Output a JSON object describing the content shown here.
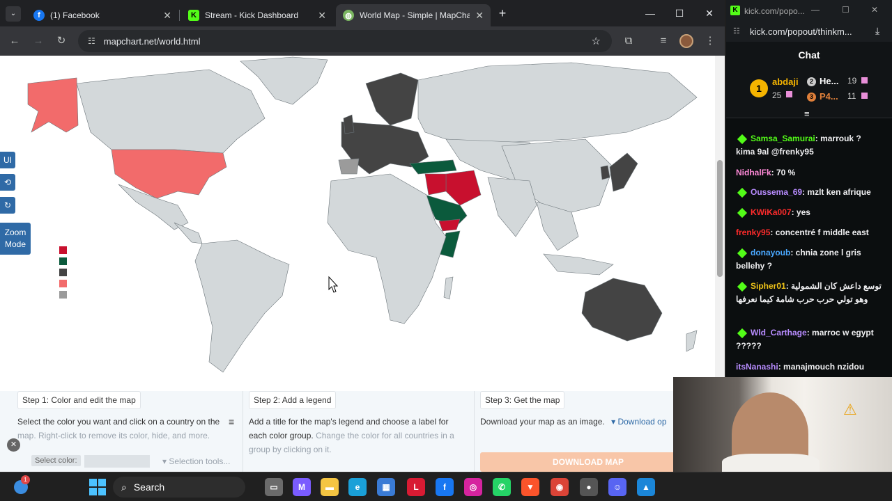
{
  "browser": {
    "tabs": [
      {
        "title": "(1) Facebook",
        "icon": "facebook-icon",
        "color": "#1877f2",
        "glyph": "f"
      },
      {
        "title": "Stream - Kick Dashboard",
        "icon": "kick-icon",
        "color": "#53fc18",
        "glyph": "K"
      },
      {
        "title": "World Map - Simple | MapChar",
        "icon": "globe-icon",
        "color": "#7bb661",
        "glyph": "◍"
      }
    ],
    "url": "mapchart.net/world.html"
  },
  "mapchart": {
    "side_buttons": [
      "UI",
      "⟲",
      "↻",
      "Zoom Mode"
    ],
    "legend_colors": [
      "#c8102e",
      "#0b5a3c",
      "#444444",
      "#f26b6b",
      "#9b9b9b"
    ],
    "steps": [
      {
        "tab": "Step 1: Color and edit the map",
        "text": "Select the color you want and click on a country on the",
        "muted": "map. Right-click to remove its color, hide, and more.",
        "select_label": "Select color:",
        "tools": "▾ Selection tools..."
      },
      {
        "tab": "Step 2: Add a legend",
        "text": "Add a title for the map's legend and choose a label for",
        "text2": "each color group.",
        "muted": "Change the color for all countries in a group by clicking on it."
      },
      {
        "tab": "Step 3: Get the map",
        "text": "Download your map as an image.",
        "link": "▾ Download op",
        "download": "DOWNLOAD MAP"
      }
    ]
  },
  "chat": {
    "window_url_short": "kick.com/popo...",
    "url": "kick.com/popout/thinkm...",
    "title": "Chat",
    "leaders": [
      {
        "rank": "1",
        "name": "abdaji",
        "count": "25"
      },
      {
        "rank": "2",
        "name": "He...",
        "count": "19"
      },
      {
        "rank": "3",
        "name": "P4...",
        "count": "11"
      }
    ],
    "messages": [
      {
        "user": "Samsa_Samurai",
        "color": "#53fc18",
        "badge": true,
        "text": ": marrouk ? kima 9al @frenky95"
      },
      {
        "user": "NidhalFk",
        "color": "#ff8ad8",
        "badge": false,
        "text": ": 70 %"
      },
      {
        "user": "Oussema_69",
        "color": "#b88cff",
        "badge": true,
        "text": ": mzlt ken afrique"
      },
      {
        "user": "KWiKa007",
        "color": "#ff2b2b",
        "badge": true,
        "text": ": yes"
      },
      {
        "user": "frenky95",
        "color": "#ff2b2b",
        "badge": false,
        "text": ": concentré f middle east"
      },
      {
        "user": "donayoub",
        "color": "#4aa8ff",
        "badge": true,
        "text": ": chnia zone l gris bellehy ?"
      },
      {
        "user": "Sipher01",
        "color": "#f0c419",
        "badge": true,
        "text": ": توسع داعش كان الشمولية وهو تولي حرب حرب شامة كيما نعرفها"
      },
      {
        "user": "Wld_Carthage",
        "color": "#b88cff",
        "badge": true,
        "text": ": marroc w egypt ?????"
      },
      {
        "user": "itsNanashi",
        "color": "#b88cff",
        "badge": false,
        "text": ": manajmouch nzidou"
      }
    ]
  },
  "taskbar": {
    "search": "Search",
    "apps": [
      {
        "name": "file-explorer-icon",
        "color": "#f4c542",
        "glyph": "▬"
      },
      {
        "name": "edge-icon",
        "color": "#1aa0d8",
        "glyph": "e"
      },
      {
        "name": "store-icon",
        "color": "#3a7bd5",
        "glyph": "▦"
      },
      {
        "name": "letter-l-app-icon",
        "color": "#d81b33",
        "glyph": "L"
      },
      {
        "name": "facebook-icon",
        "color": "#1877f2",
        "glyph": "f"
      },
      {
        "name": "instagram-icon",
        "color": "#d6249f",
        "glyph": "◎"
      },
      {
        "name": "whatsapp-icon",
        "color": "#25d366",
        "glyph": "✆"
      },
      {
        "name": "brave-icon",
        "color": "#fb542b",
        "glyph": "▼"
      },
      {
        "name": "chrome-icon",
        "color": "#db4437",
        "glyph": "◉"
      },
      {
        "name": "obs-icon",
        "color": "#555555",
        "glyph": "●"
      },
      {
        "name": "discord-icon",
        "color": "#5865f2",
        "glyph": "☺"
      },
      {
        "name": "photos-icon",
        "color": "#1b86d8",
        "glyph": "▲"
      }
    ]
  }
}
